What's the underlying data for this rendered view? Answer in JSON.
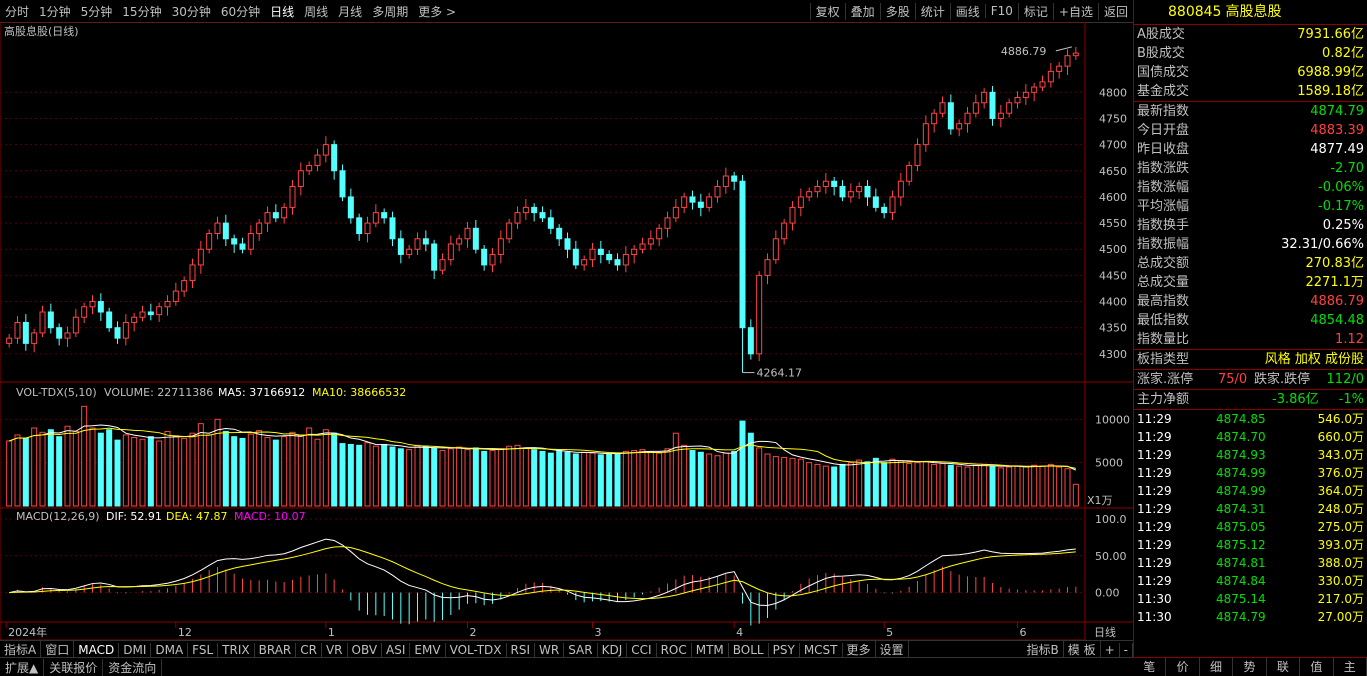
{
  "toolbar": {
    "timeframes": [
      "分时",
      "1分钟",
      "5分钟",
      "15分钟",
      "30分钟",
      "60分钟",
      "日线",
      "周线",
      "月线",
      "多周期",
      "更多 >"
    ],
    "active_timeframe": "日线",
    "right_tools": [
      "复权",
      "叠加",
      "多股",
      "统计",
      "画线",
      "F10",
      "标记",
      "+自选",
      "返回"
    ]
  },
  "chart": {
    "title": "高股息股(日线)",
    "high_label": "4886.79",
    "low_label": "4264.17",
    "volume_legend": {
      "name": "VOL-TDX(5,10)",
      "volume": "VOLUME: 22711386",
      "ma5": "MA5: 37166912",
      "ma10": "MA10: 38666532"
    },
    "macd_legend": {
      "name": "MACD(12,26,9)",
      "dif": "DIF: 52.91",
      "dea": "DEA: 47.87",
      "macd": "MACD: 10.07"
    },
    "volume_unit": "X1万",
    "x_labels": [
      "2024年",
      "12",
      "1",
      "2",
      "3",
      "4",
      "5",
      "6"
    ],
    "bottom_right_label": "日线"
  },
  "chart_data": {
    "type": "candlestick",
    "price_axis": {
      "ticks": [
        4300,
        4350,
        4400,
        4450,
        4500,
        4550,
        4600,
        4650,
        4700,
        4750,
        4800
      ],
      "range": [
        4250,
        4900
      ]
    },
    "volume_axis": {
      "ticks": [
        5000,
        10000
      ],
      "range": [
        0,
        12000
      ]
    },
    "macd_axis": {
      "ticks": [
        "100.0",
        "50.00",
        "0.00"
      ],
      "range": [
        -40,
        115
      ]
    },
    "x_label_bar_index": [
      0,
      20,
      38,
      55,
      70,
      87,
      105,
      121
    ],
    "closes": [
      4330,
      4360,
      4320,
      4340,
      4380,
      4350,
      4330,
      4340,
      4370,
      4390,
      4400,
      4380,
      4350,
      4330,
      4360,
      4370,
      4380,
      4375,
      4390,
      4400,
      4420,
      4440,
      4470,
      4500,
      4530,
      4550,
      4520,
      4510,
      4500,
      4530,
      4550,
      4570,
      4560,
      4580,
      4620,
      4650,
      4660,
      4680,
      4700,
      4650,
      4600,
      4560,
      4530,
      4550,
      4570,
      4560,
      4520,
      4490,
      4500,
      4520,
      4510,
      4460,
      4480,
      4510,
      4520,
      4540,
      4500,
      4470,
      4490,
      4520,
      4550,
      4570,
      4580,
      4570,
      4560,
      4540,
      4520,
      4500,
      4470,
      4480,
      4500,
      4490,
      4480,
      4470,
      4490,
      4500,
      4510,
      4520,
      4540,
      4560,
      4580,
      4600,
      4590,
      4580,
      4600,
      4620,
      4640,
      4630,
      4350,
      4300,
      4450,
      4480,
      4520,
      4550,
      4580,
      4600,
      4610,
      4620,
      4630,
      4620,
      4600,
      4610,
      4620,
      4600,
      4580,
      4570,
      4600,
      4630,
      4660,
      4700,
      4740,
      4760,
      4780,
      4730,
      4740,
      4760,
      4780,
      4800,
      4750,
      4760,
      4780,
      4790,
      4800,
      4810,
      4820,
      4840,
      4850,
      4870,
      4875
    ],
    "volumes_wan": [
      7500,
      8200,
      7800,
      9000,
      8500,
      8800,
      8000,
      9200,
      8600,
      11500,
      9000,
      8400,
      8800,
      7600,
      8200,
      7900,
      7700,
      8000,
      7500,
      8600,
      8100,
      7800,
      8400,
      9500,
      8200,
      10000,
      8600,
      8000,
      7800,
      8300,
      8700,
      7900,
      7600,
      8000,
      8500,
      8200,
      9000,
      7700,
      8800,
      8400,
      7200,
      7100,
      7000,
      7300,
      6900,
      7100,
      6800,
      6600,
      6500,
      7000,
      6900,
      6700,
      6400,
      6600,
      6800,
      6500,
      6700,
      6300,
      6400,
      6600,
      6900,
      7000,
      6700,
      6500,
      6300,
      6100,
      6400,
      6200,
      6000,
      6200,
      6100,
      5900,
      6000,
      6100,
      6300,
      6400,
      6500,
      6200,
      6100,
      6600,
      8400,
      7000,
      6400,
      6200,
      6000,
      5800,
      6100,
      6300,
      9800,
      8400,
      6700,
      6000,
      5700,
      5600,
      5500,
      5400,
      5000,
      4800,
      4600,
      4500,
      4800,
      5000,
      5300,
      5100,
      5500,
      5000,
      5400,
      5200,
      4900,
      5000,
      5100,
      4800,
      4900,
      4700,
      4600,
      4500,
      4700,
      4800,
      4600,
      4400,
      4500,
      4600,
      4500,
      4700,
      4600,
      4800,
      4500,
      4300,
      2500
    ],
    "ma5_wan": 3716.6912,
    "ma10_wan": 3866.6532
  },
  "panel": {
    "code": "880845",
    "name": "高股息股",
    "rows": [
      {
        "label": "A股成交",
        "value": "7931.66亿",
        "color": "yellow"
      },
      {
        "label": "B股成交",
        "value": "0.82亿",
        "color": "yellow"
      },
      {
        "label": "国债成交",
        "value": "6988.99亿",
        "color": "yellow"
      },
      {
        "label": "基金成交",
        "value": "1589.18亿",
        "color": "yellow"
      },
      {
        "label": "最新指数",
        "value": "4874.79",
        "color": "green"
      },
      {
        "label": "今日开盘",
        "value": "4883.39",
        "color": "red"
      },
      {
        "label": "昨日收盘",
        "value": "4877.49",
        "color": "white"
      },
      {
        "label": "指数涨跌",
        "value": "-2.70",
        "color": "green"
      },
      {
        "label": "指数涨幅",
        "value": "-0.06%",
        "color": "green"
      },
      {
        "label": "平均涨幅",
        "value": "-0.17%",
        "color": "green"
      },
      {
        "label": "指数换手",
        "value": "0.25%",
        "color": "white"
      },
      {
        "label": "指数振幅",
        "value": "32.31/0.66%",
        "color": "white"
      },
      {
        "label": "总成交额",
        "value": "270.83亿",
        "color": "yellow"
      },
      {
        "label": "总成交量",
        "value": "2271.1万",
        "color": "yellow"
      },
      {
        "label": "最高指数",
        "value": "4886.79",
        "color": "red"
      },
      {
        "label": "最低指数",
        "value": "4854.48",
        "color": "green"
      },
      {
        "label": "指数量比",
        "value": "1.12",
        "color": "red"
      }
    ],
    "board_type_label": "板指类型",
    "board_type_value": "风格 加权 成份股",
    "up_label": "涨家.涨停",
    "up_value": "75/0",
    "down_label": "跌家.跌停",
    "down_value": "112/0",
    "main_flow_label": "主力净额",
    "main_flow_value": "-3.86亿",
    "main_flow_pct": "-1%",
    "ticks": [
      {
        "time": "11:29",
        "price": "4874.85",
        "vol": "546.0万"
      },
      {
        "time": "11:29",
        "price": "4874.70",
        "vol": "660.0万"
      },
      {
        "time": "11:29",
        "price": "4874.93",
        "vol": "343.0万"
      },
      {
        "time": "11:29",
        "price": "4874.99",
        "vol": "376.0万"
      },
      {
        "time": "11:29",
        "price": "4874.99",
        "vol": "364.0万"
      },
      {
        "time": "11:29",
        "price": "4874.31",
        "vol": "248.0万"
      },
      {
        "time": "11:29",
        "price": "4875.05",
        "vol": "275.0万"
      },
      {
        "time": "11:29",
        "price": "4875.12",
        "vol": "393.0万"
      },
      {
        "time": "11:29",
        "price": "4874.81",
        "vol": "388.0万"
      },
      {
        "time": "11:29",
        "price": "4874.84",
        "vol": "330.0万"
      },
      {
        "time": "11:30",
        "price": "4875.14",
        "vol": "217.0万"
      },
      {
        "time": "11:30",
        "price": "4874.79",
        "vol": "27.00万"
      }
    ],
    "tabs": [
      "笔",
      "价",
      "细",
      "势",
      "联",
      "值",
      "主"
    ]
  },
  "indicators": [
    "指标A",
    "窗口",
    "MACD",
    "DMI",
    "DMA",
    "FSL",
    "TRIX",
    "BRAR",
    "CR",
    "VR",
    "OBV",
    "ASI",
    "EMV",
    "VOL-TDX",
    "RSI",
    "WR",
    "SAR",
    "KDJ",
    "CCI",
    "ROC",
    "MTM",
    "BOLL",
    "PSY",
    "MCST",
    "更多",
    "设置"
  ],
  "active_indicator": "MACD",
  "indicator_right": [
    "指标B",
    "模 板",
    "+",
    "-"
  ],
  "bottom_tabs": [
    "扩展▲",
    "关联报价",
    "资金流向"
  ],
  "colors": {
    "up": "#ff4444",
    "down": "#54ffff",
    "ma5": "#ffffff",
    "ma10": "#ffff00",
    "axis": "#8b0000",
    "macd_purple": "#ff00ff"
  }
}
